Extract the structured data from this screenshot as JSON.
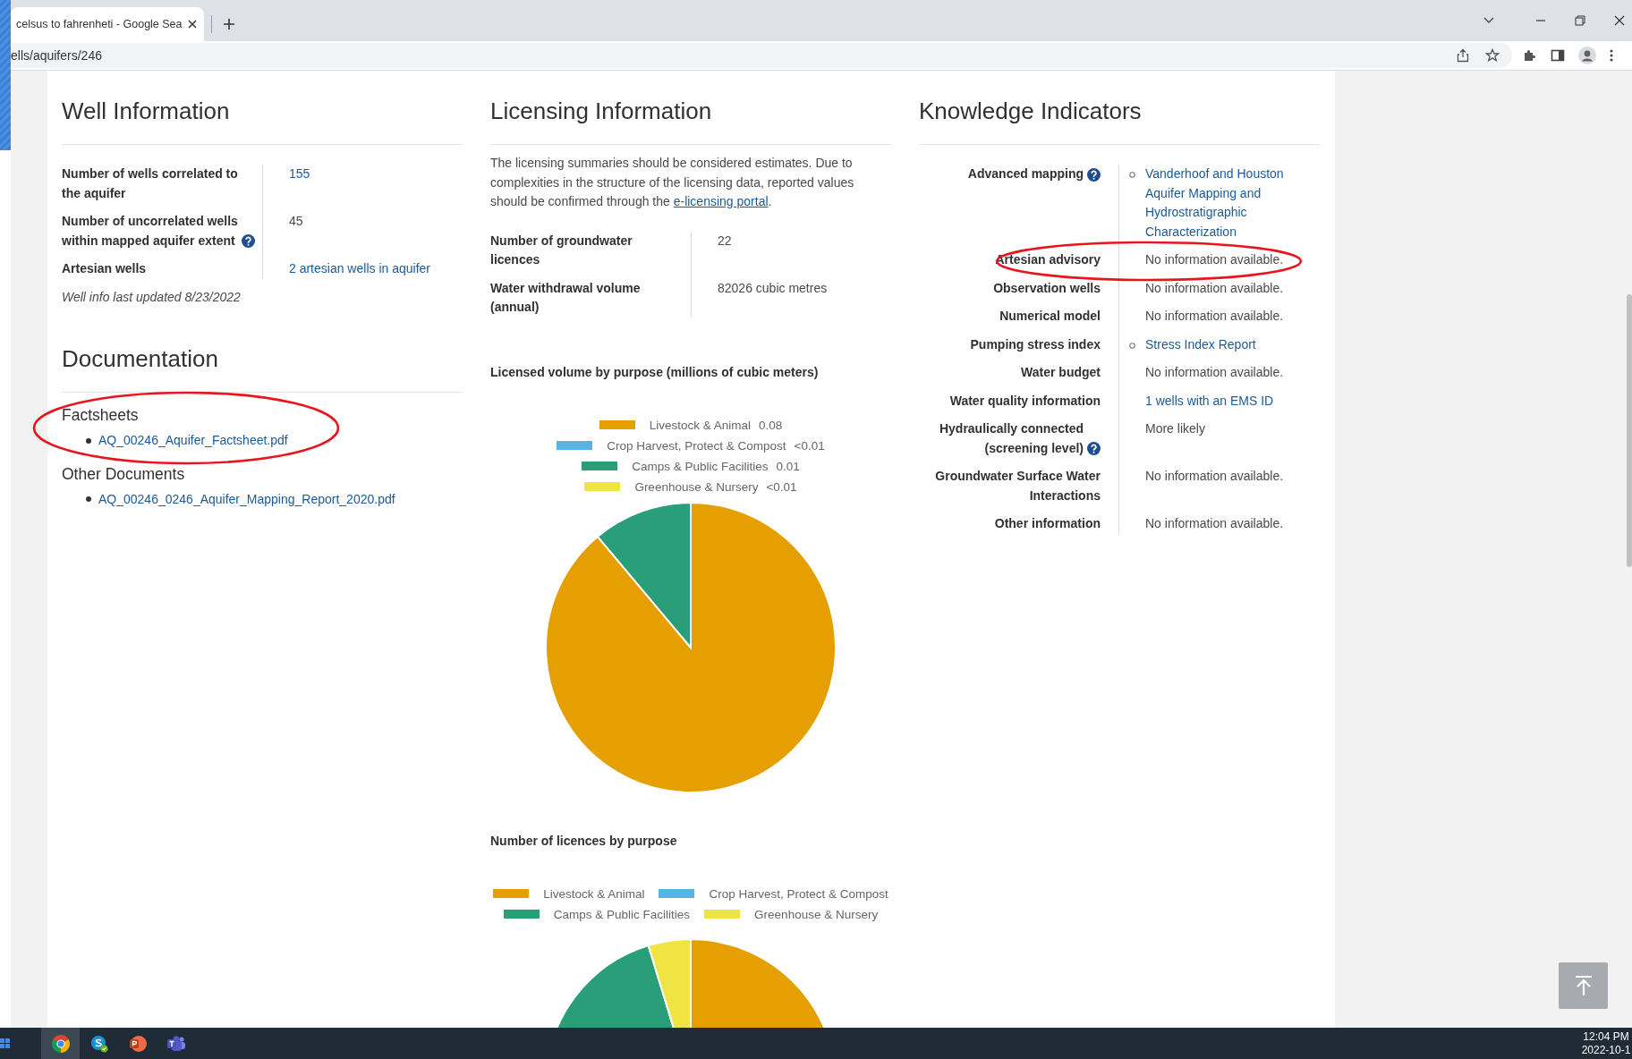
{
  "browser": {
    "tabs": [
      {
        "title": "celsus to fahrenheti - Google Sea",
        "selected": true
      }
    ],
    "address": "ells/aquifers/246"
  },
  "well_information": {
    "title": "Well Information",
    "rows": [
      {
        "label": "Number of wells correlated to the aquifer",
        "help": false,
        "kind": "link",
        "value": "155"
      },
      {
        "label": "Number of uncorrelated wells within mapped aquifer extent",
        "help": true,
        "kind": "text",
        "value": "45"
      },
      {
        "label": "Artesian wells",
        "help": false,
        "kind": "link",
        "value": "2 artesian wells in aquifer"
      }
    ],
    "note": "Well info last updated 8/23/2022"
  },
  "documentation": {
    "title": "Documentation",
    "groups": [
      {
        "title": "Factsheets",
        "highlighted": true,
        "files": [
          "AQ_00246_Aquifer_Factsheet.pdf"
        ]
      },
      {
        "title": "Other Documents",
        "highlighted": false,
        "files": [
          "AQ_00246_0246_Aquifer_Mapping_Report_2020.pdf"
        ]
      }
    ]
  },
  "licensing_information": {
    "title": "Licensing Information",
    "intro": {
      "text": "The licensing summaries should be considered estimates. Due to complexities in the structure of the licensing data, reported values should be confirmed through the ",
      "link": "e-licensing portal",
      "end": "."
    },
    "rows": [
      {
        "label": "Number of groundwater licences",
        "value": "22"
      },
      {
        "label": "Water withdrawal volume (annual)",
        "value": "82026 cubic metres"
      }
    ],
    "volume_chart": {
      "chart_data": {
        "type": "pie",
        "title": "Licensed volume by purpose (millions of cubic meters)",
        "categories": [
          "Livestock & Animal",
          "Crop Harvest, Protect & Compost",
          "Camps & Public Facilities",
          "Greenhouse & Nursery"
        ],
        "values": [
          0.08,
          0,
          0.01,
          0
        ],
        "colors": [
          "#e69f00",
          "#56b4e9",
          "#2a9e78",
          "#f0e442"
        ],
        "legend": "top",
        "value_labels": [
          "0.08",
          "<0.01",
          "0.01",
          "<0.01"
        ]
      }
    },
    "count_chart": {
      "title": "Number of licences by purpose",
      "legend": [
        {
          "label": "Livestock & Animal",
          "color": "#e69f00"
        },
        {
          "label": "Crop Harvest, Protect & Compost",
          "color": "#56b4e9"
        },
        {
          "label": "Camps & Public Facilities",
          "color": "#2a9e78"
        },
        {
          "label": "Greenhouse & Nursery",
          "color": "#f0e442"
        }
      ]
    }
  },
  "knowledge_indicators": {
    "title": "Knowledge Indicators",
    "rows": [
      {
        "label": "Advanced mapping",
        "help": true,
        "kind": "list",
        "value": "Vanderhoof and Houston Aquifer Mapping and Hydrostratigraphic Characterization",
        "highlighted": false
      },
      {
        "label": "Artesian advisory",
        "help": false,
        "kind": "text",
        "value": "No information available.",
        "highlighted": true
      },
      {
        "label": "Observation wells",
        "help": false,
        "kind": "text",
        "value": "No information available.",
        "highlighted": false
      },
      {
        "label": "Numerical model",
        "help": false,
        "kind": "text",
        "value": "No information available.",
        "highlighted": false
      },
      {
        "label": "Pumping stress index",
        "help": false,
        "kind": "list",
        "value": "Stress Index Report",
        "highlighted": false
      },
      {
        "label": "Water budget",
        "help": false,
        "kind": "text",
        "value": "No information available.",
        "highlighted": false
      },
      {
        "label": "Water quality information",
        "help": false,
        "kind": "link",
        "value": "1 wells with an EMS ID",
        "highlighted": false
      },
      {
        "label": "Hydraulically connected (screening level)",
        "help": true,
        "kind": "text",
        "value": "More likely",
        "highlighted": false
      },
      {
        "label": "Groundwater Surface Water Interactions",
        "help": false,
        "kind": "text",
        "value": "No information available.",
        "highlighted": false
      },
      {
        "label": "Other information",
        "help": false,
        "kind": "text",
        "value": "No information available.",
        "highlighted": false
      }
    ]
  },
  "taskbar": {
    "apps": [
      {
        "kind": "browser",
        "selected": true
      },
      {
        "kind": "chat",
        "selected": false
      },
      {
        "kind": "slides",
        "selected": false
      },
      {
        "kind": "teams",
        "selected": false
      }
    ],
    "time": "12:04 PM",
    "date": "2022-10-1"
  }
}
